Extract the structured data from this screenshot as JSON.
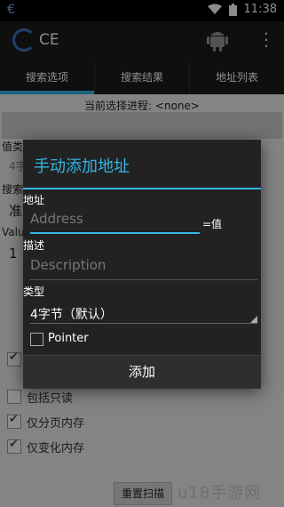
{
  "status_bar": {
    "time": "11:38"
  },
  "action_bar": {
    "title": "CE"
  },
  "tabs": [
    {
      "label": "搜索选项",
      "active": true
    },
    {
      "label": "搜索结果",
      "active": false
    },
    {
      "label": "地址列表",
      "active": false
    }
  ],
  "process_label": "当前选择进程: <none>",
  "background": {
    "value_type_label": "值类",
    "value_type_partial": "4字",
    "search_label": "搜索",
    "search_partial": "准",
    "value_label": "Valu",
    "value_partial": "1",
    "options": [
      {
        "label": "包括只读",
        "checked": false
      },
      {
        "label": "仅分页内存",
        "checked": true
      },
      {
        "label": "仅变化内存",
        "checked": true
      }
    ],
    "reset_button": "重置扫描",
    "watermark": "u18手游网"
  },
  "dialog": {
    "title": "手动添加地址",
    "address_label": "地址",
    "address_placeholder": "Address",
    "equals_value": "=值",
    "description_label": "描述",
    "description_placeholder": "Description",
    "type_label": "类型",
    "type_value": "4字节（默认）",
    "pointer_label": "Pointer",
    "pointer_checked": false,
    "add_button": "添加"
  },
  "colors": {
    "accent": "#33b5e5",
    "bar": "#1c1c1c"
  }
}
